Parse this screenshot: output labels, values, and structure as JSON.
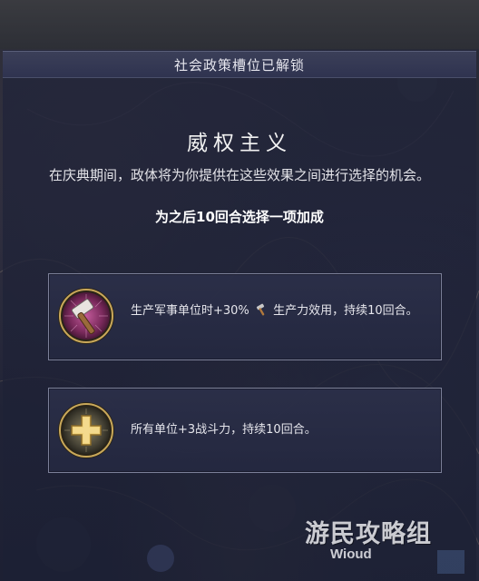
{
  "header": {
    "title": "社会政策槽位已解锁"
  },
  "government": {
    "name": "威权主义",
    "description": "在庆典期间，政体将为你提供在这些效果之间进行选择的机会。",
    "bonus_prompt": "为之后10回合选择一项加成"
  },
  "options": [
    {
      "icon": "hammer-icon",
      "text_before": "生产军事单位时+30%",
      "inline_icon": "production-hammer-icon",
      "text_after": "生产力效用，持续10回合。"
    },
    {
      "icon": "plus-cross-icon",
      "text": "所有单位+3战斗力，持续10回合。"
    }
  ],
  "watermark": {
    "title": "游民攻略组",
    "subtitle": "Wioud"
  },
  "colors": {
    "panel_bg": "#22253a",
    "header_bg": "#353a55",
    "option_border": "#7c8098",
    "hammer_icon_bg": "#8a3a6a",
    "plus_icon_bg": "#3a3a34",
    "gold": "#e8c46a"
  }
}
